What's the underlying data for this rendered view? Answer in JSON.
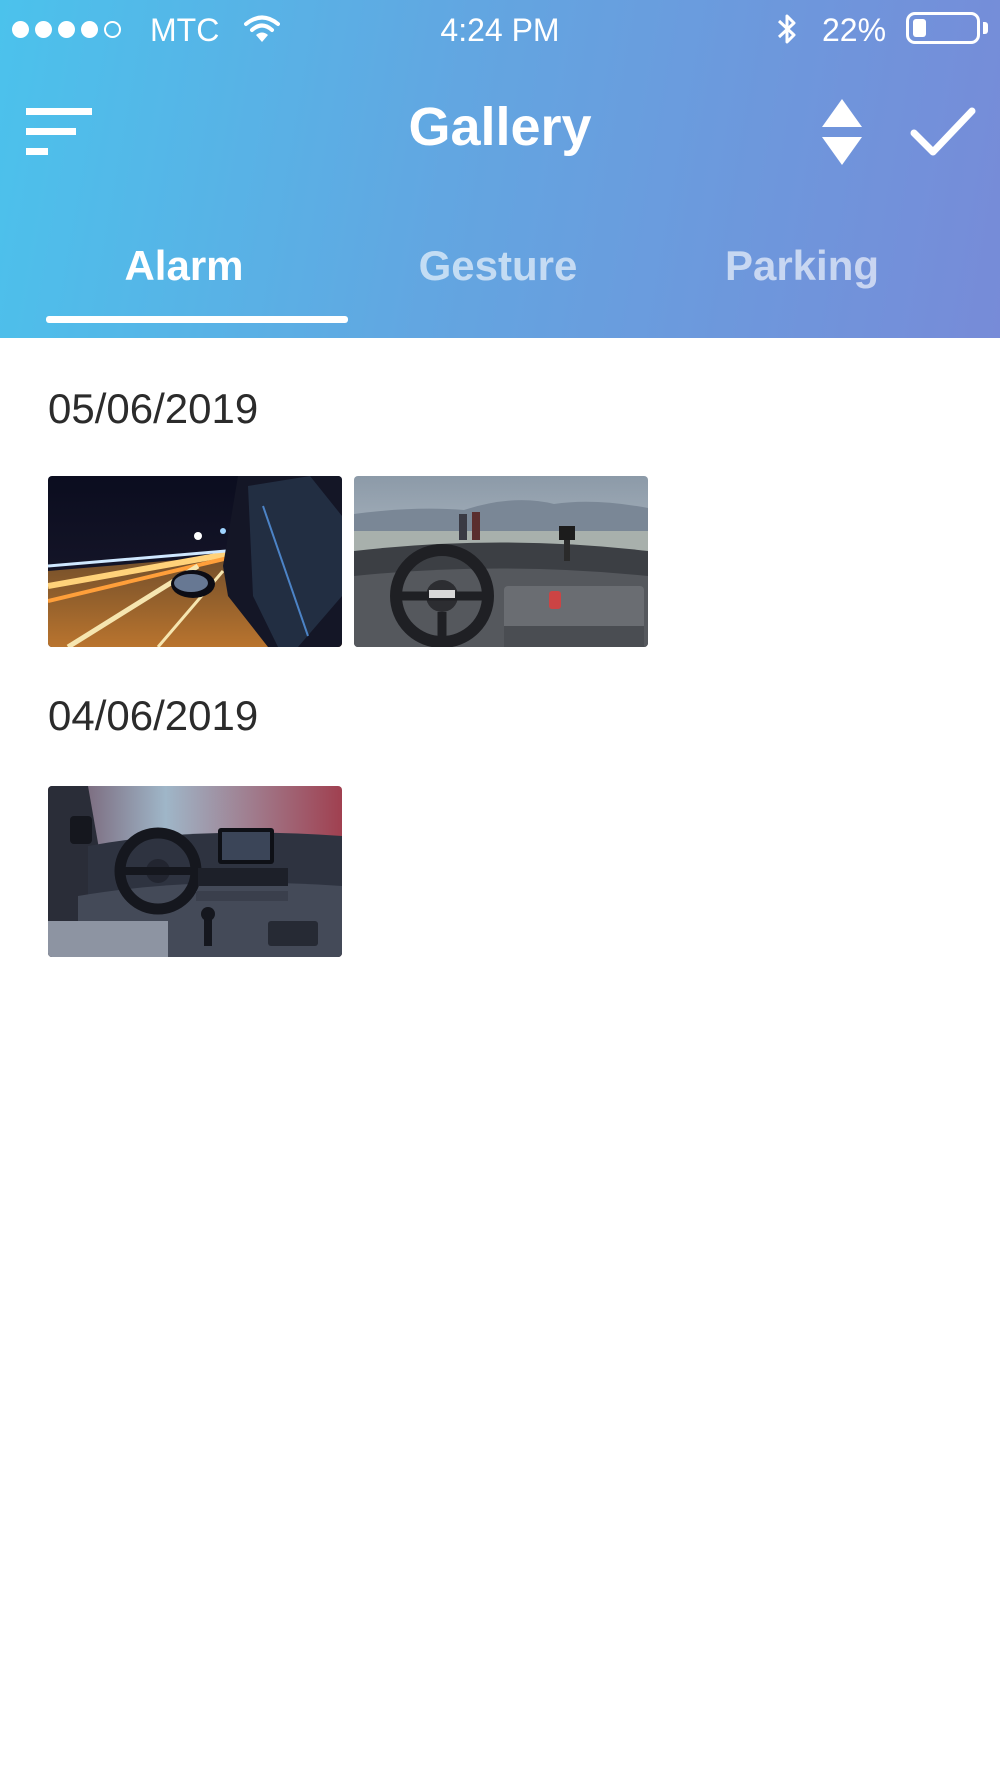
{
  "status_bar": {
    "carrier": "MTC",
    "time": "4:24 PM",
    "battery_percent": "22%",
    "battery_level": 0.22,
    "signal_bars_filled": 4,
    "signal_bars_total": 5
  },
  "nav": {
    "title": "Gallery"
  },
  "tabs": [
    {
      "label": "Alarm",
      "active": true
    },
    {
      "label": "Gesture",
      "active": false
    },
    {
      "label": "Parking",
      "active": false
    }
  ],
  "sections": [
    {
      "date": "05/06/2019",
      "thumbnails": [
        "night-highway-car-mirror",
        "truck-cab-dashboard"
      ]
    },
    {
      "date": "04/06/2019",
      "thumbnails": [
        "van-interior-dashboard"
      ]
    }
  ],
  "colors": {
    "header_gradient_start": "#4bc2ec",
    "header_gradient_end": "#778bd8",
    "active_text": "#ffffff"
  }
}
